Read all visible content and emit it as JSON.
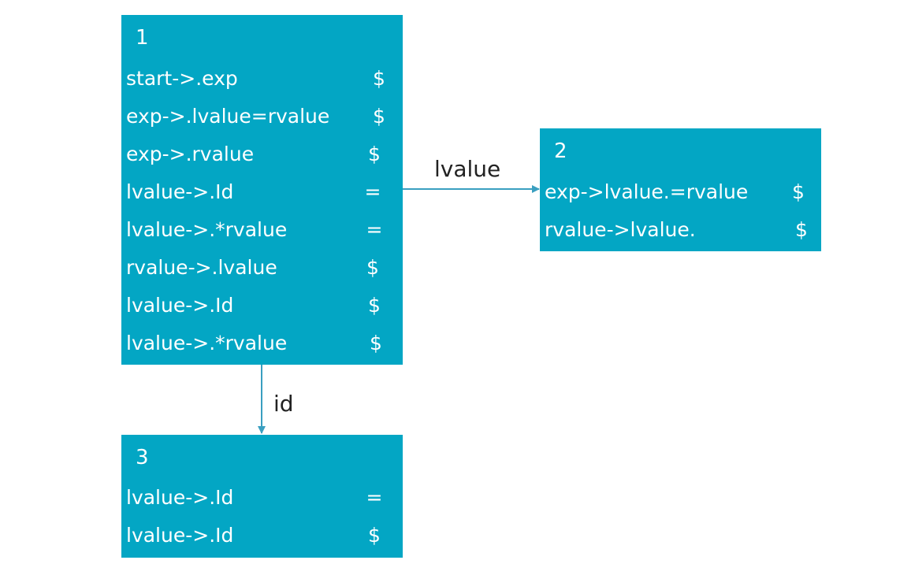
{
  "states": [
    {
      "number": "1",
      "items": [
        {
          "production": "start->.exp",
          "lookahead": "$"
        },
        {
          "production": "exp->.lvalue=rvalue",
          "lookahead": "$"
        },
        {
          "production": "exp->.rvalue",
          "lookahead": "$"
        },
        {
          "production": "lvalue->.Id",
          "lookahead": "="
        },
        {
          "production": "lvalue->.*rvalue",
          "lookahead": "="
        },
        {
          "production": "rvalue->.lvalue",
          "lookahead": "$"
        },
        {
          "production": "lvalue->.Id",
          "lookahead": "$"
        },
        {
          "production": "lvalue->.*rvalue",
          "lookahead": "$"
        }
      ]
    },
    {
      "number": "2",
      "items": [
        {
          "production": "exp->lvalue.=rvalue",
          "lookahead": "$"
        },
        {
          "production": "rvalue->lvalue.",
          "lookahead": "$"
        }
      ]
    },
    {
      "number": "3",
      "items": [
        {
          "production": "lvalue->.Id",
          "lookahead": "="
        },
        {
          "production": "lvalue->.Id",
          "lookahead": "$"
        }
      ]
    }
  ],
  "transitions": [
    {
      "from": "1",
      "to": "2",
      "label": "lvalue"
    },
    {
      "from": "1",
      "to": "3",
      "label": "id"
    }
  ],
  "colors": {
    "state_fill": "#03a6c4",
    "state_text": "#ffffff",
    "arrow": "#3a9fc0",
    "label_text": "#222222"
  }
}
